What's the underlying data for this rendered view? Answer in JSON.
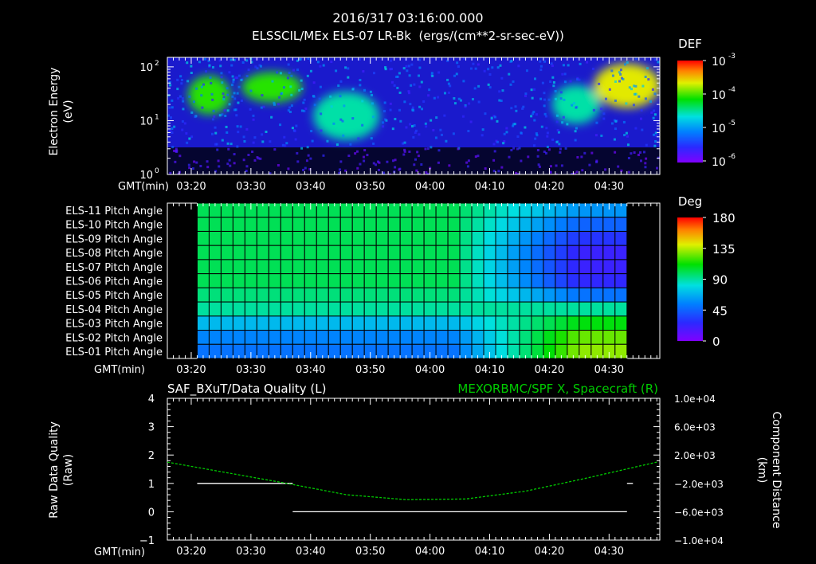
{
  "header": {
    "timestamp": "2016/317 03:16:00.000",
    "subtitle": "ELSSCIL/MEx ELS-07 LR-Bk  (ergs/(cm**2-sr-sec-eV))"
  },
  "colors": {
    "background": "#000000",
    "axes": "#ffffff",
    "spacecraft_line": "#00cc00",
    "quality_line": "#ffffff"
  },
  "chart_data": [
    {
      "type": "heatmap",
      "panel": "energy-spectrogram",
      "ylabel": [
        "Electron Energy",
        "(eV)"
      ],
      "xlabel": "GMT(min)",
      "x_ticks": [
        "03:20",
        "03:30",
        "03:40",
        "03:50",
        "04:00",
        "04:10",
        "04:20",
        "04:30"
      ],
      "xlim": [
        "03:16",
        "03:38+60"
      ],
      "y_scale": "log",
      "ylim": [
        1,
        150
      ],
      "y_ticks": [
        {
          "base": "10",
          "exp": "0"
        },
        {
          "base": "10",
          "exp": "1"
        },
        {
          "base": "10",
          "exp": "2"
        }
      ],
      "colorbar": {
        "label": "DEF",
        "scale": "log",
        "ticks": [
          {
            "base": "10",
            "exp": "-3"
          },
          {
            "base": "10",
            "exp": "-4"
          },
          {
            "base": "10",
            "exp": "-5"
          },
          {
            "base": "10",
            "exp": "-6"
          }
        ]
      },
      "features": [
        {
          "time_min": [
            4,
            10
          ],
          "energy_eV": [
            15,
            60
          ],
          "level": "1e-4"
        },
        {
          "time_min": [
            13,
            22
          ],
          "energy_eV": [
            25,
            70
          ],
          "level": "1e-4"
        },
        {
          "time_min": [
            25,
            35
          ],
          "energy_eV": [
            5,
            30
          ],
          "level": "3e-5"
        },
        {
          "time_min": [
            65,
            72
          ],
          "energy_eV": [
            10,
            40
          ],
          "level": "3e-5"
        },
        {
          "time_min": [
            72,
            82
          ],
          "energy_eV": [
            20,
            100
          ],
          "level": "3e-4"
        }
      ]
    },
    {
      "type": "heatmap",
      "panel": "pitch-angle",
      "xlabel": "GMT(min)",
      "x_ticks": [
        "03:20",
        "03:30",
        "03:40",
        "03:50",
        "04:00",
        "04:10",
        "04:20",
        "04:30"
      ],
      "rows": [
        "ELS-11 Pitch Angle",
        "ELS-10 Pitch Angle",
        "ELS-09 Pitch Angle",
        "ELS-08 Pitch Angle",
        "ELS-07 Pitch Angle",
        "ELS-06 Pitch Angle",
        "ELS-05 Pitch Angle",
        "ELS-04 Pitch Angle",
        "ELS-03 Pitch Angle",
        "ELS-02 Pitch Angle",
        "ELS-01 Pitch Angle"
      ],
      "colorbar": {
        "label": "Deg",
        "ticks": [
          "180",
          "135",
          "90",
          "45",
          "0"
        ],
        "range": [
          0,
          180
        ]
      },
      "time_range_min": [
        5,
        77
      ],
      "values_start": [
        100,
        100,
        100,
        100,
        100,
        100,
        95,
        90,
        70,
        55,
        50
      ],
      "values_end": [
        60,
        45,
        30,
        22,
        22,
        25,
        50,
        90,
        110,
        125,
        130
      ]
    },
    {
      "type": "line",
      "panel": "quality-and-position",
      "title_left": "SAF_BXuT/Data Quality (L)",
      "title_right": "MEXORBMC/SPF X, Spacecraft (R)",
      "ylabel_left": [
        "Raw Data Quality",
        "(Raw)"
      ],
      "ylabel_right": [
        "Component Distance",
        "(km)"
      ],
      "xlabel": "GMT(min)",
      "x_ticks": [
        "03:20",
        "03:30",
        "03:40",
        "03:50",
        "04:00",
        "04:10",
        "04:20",
        "04:30"
      ],
      "ylim_left": [
        -1,
        4
      ],
      "left_ticks": [
        "4",
        "3",
        "2",
        "1",
        "0",
        "−1"
      ],
      "ylim_right": [
        -10000,
        10000
      ],
      "right_ticks": [
        "1.0e+04",
        "6.0e+03",
        "2.0e+03",
        "−2.0e+03",
        "−6.0e+03",
        "−1.0e+04"
      ],
      "series": [
        {
          "name": "SAF_BXuT/Data Quality",
          "axis": "left",
          "segments": [
            {
              "x_min": [
                5,
                21
              ],
              "y": 1
            },
            {
              "x_min": [
                21,
                77
              ],
              "y": 0
            },
            {
              "x_min": [
                77,
                78
              ],
              "y": 1
            }
          ]
        },
        {
          "name": "MEXORBMC/SPF X, Spacecraft",
          "axis": "right",
          "x_min": [
            0,
            10,
            20,
            30,
            40,
            50,
            60,
            70,
            82
          ],
          "y_km": [
            1000,
            -500,
            -2000,
            -3600,
            -4300,
            -4200,
            -3100,
            -1300,
            1000
          ]
        }
      ]
    }
  ]
}
